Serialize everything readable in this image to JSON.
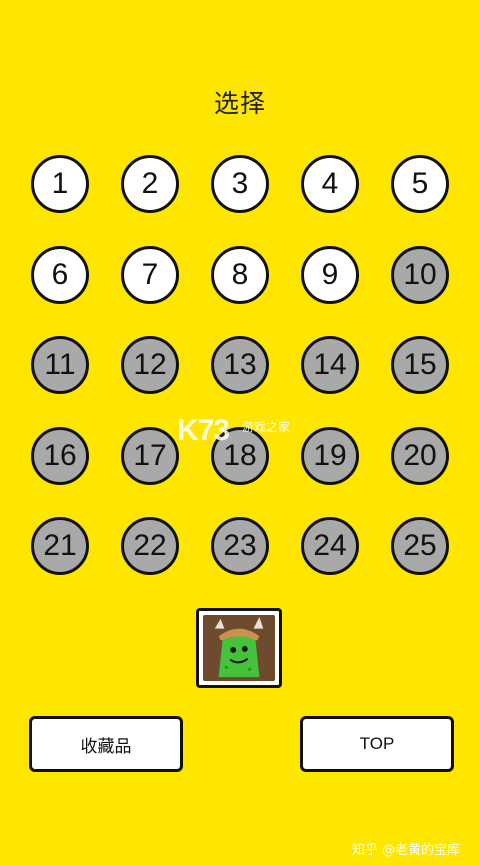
{
  "title": "选择",
  "levels": [
    {
      "label": "1",
      "locked": false
    },
    {
      "label": "2",
      "locked": false
    },
    {
      "label": "3",
      "locked": false
    },
    {
      "label": "4",
      "locked": false
    },
    {
      "label": "5",
      "locked": false
    },
    {
      "label": "6",
      "locked": false
    },
    {
      "label": "7",
      "locked": false
    },
    {
      "label": "8",
      "locked": false
    },
    {
      "label": "9",
      "locked": false
    },
    {
      "label": "10",
      "locked": true
    },
    {
      "label": "11",
      "locked": true
    },
    {
      "label": "12",
      "locked": true
    },
    {
      "label": "13",
      "locked": true
    },
    {
      "label": "14",
      "locked": true
    },
    {
      "label": "15",
      "locked": true
    },
    {
      "label": "16",
      "locked": true
    },
    {
      "label": "17",
      "locked": true
    },
    {
      "label": "18",
      "locked": true
    },
    {
      "label": "19",
      "locked": true
    },
    {
      "label": "20",
      "locked": true
    },
    {
      "label": "21",
      "locked": true
    },
    {
      "label": "22",
      "locked": true
    },
    {
      "label": "23",
      "locked": true
    },
    {
      "label": "24",
      "locked": true
    },
    {
      "label": "25",
      "locked": true
    }
  ],
  "buttons": {
    "collection_label": "收藏品",
    "top_label": "TOP"
  },
  "watermarks": {
    "site_logo": "K73",
    "site_sub": "游戏之家",
    "zhihu": "知乎 @老黄的宝库"
  },
  "colors": {
    "background": "#FFE600",
    "unlocked": "#FFFFFF",
    "locked": "#A9A9A9",
    "outline": "#111111"
  }
}
